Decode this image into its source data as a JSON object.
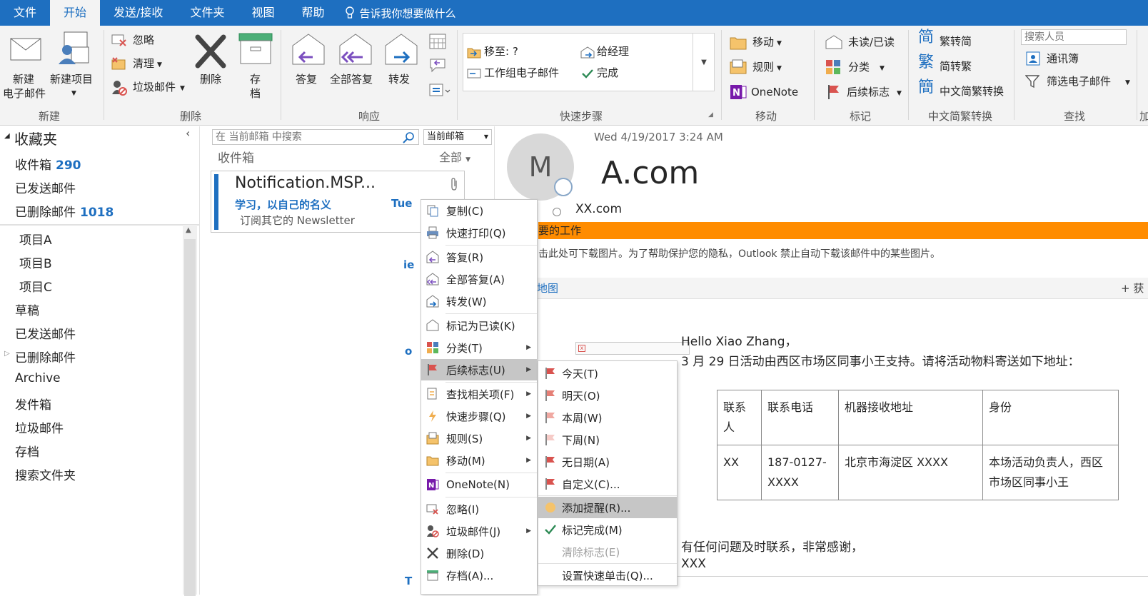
{
  "tabs": [
    "文件",
    "开始",
    "发送/接收",
    "文件夹",
    "视图",
    "帮助"
  ],
  "tell_me": "告诉我你想要做什么",
  "ribbon": {
    "new_email": [
      "新建",
      "电子邮件"
    ],
    "new_items": [
      "新建项目"
    ],
    "ignore": "忽略",
    "cleanup": "清理",
    "junk": "垃圾邮件",
    "delete": "删除",
    "archive": [
      "存",
      "档"
    ],
    "reply": "答复",
    "reply_all": "全部答复",
    "forward": "转发",
    "qs_move_to": "移至: ?",
    "qs_manager": "给经理",
    "qs_team": "工作组电子邮件",
    "qs_done": "完成",
    "move": "移动",
    "rules": "规则",
    "onenote": "OneNote",
    "unread": "未读/已读",
    "categorize": "分类",
    "followup": "后续标志",
    "trad": "繁转简",
    "simp": "简转繁",
    "convert": "中文简繁转换",
    "search_people": "搜索人员",
    "address_book": "通讯簿",
    "filter_email": "筛选电子邮件",
    "groups": {
      "new": "新建",
      "delete": "删除",
      "respond": "响应",
      "quick_steps": "快速步骤",
      "move": "移动",
      "tags": "标记",
      "cn_convert": "中文简繁转换",
      "find": "查找",
      "addin": "加"
    }
  },
  "folders": {
    "favorites": "收藏夹",
    "fav_items": [
      {
        "label": "收件箱",
        "count": "290"
      },
      {
        "label": "已发送邮件",
        "count": ""
      },
      {
        "label": "已删除邮件",
        "count": "1018"
      }
    ],
    "items": [
      "项目A",
      "项目B",
      "项目C",
      "草稿",
      "已发送邮件",
      "已删除邮件",
      "Archive",
      "发件箱",
      "垃圾邮件",
      "存档",
      "搜索文件夹"
    ]
  },
  "list": {
    "search_placeholder": "在 当前邮箱 中搜索",
    "scope": "当前邮箱",
    "folder": "收件箱",
    "filter": "全部",
    "msg_from": "Notification.MSP...",
    "msg_subject": "学习，以自己的名义",
    "msg_date": "Tue",
    "msg_preview": "订阅其它的 Newsletter",
    "frag_1": "ie",
    "frag_2": "o",
    "frag_3": "T"
  },
  "reading": {
    "date": "Wed 4/19/2017 3:24 AM",
    "avatar": "M",
    "sender": "A.com",
    "to": "XX.com",
    "banner": "要的工作",
    "info": "击此处可下载图片。为了帮助保护您的隐私，Outlook 禁止自动下载该邮件中的某些图片。",
    "map": "地图",
    "plus": "+ 获",
    "greeting": "Hello Xiao Zhang，",
    "line1": "3 月 29 日活动由西区市场区同事小王支持。请将活动物料寄送如下地址：",
    "table_head": [
      "联系人",
      "联系电话",
      "机器接收地址",
      "身份"
    ],
    "table_row": [
      "XX",
      "187-0127-XXXX",
      "北京市海淀区 XXXX",
      "本场活动负责人，西区市场区同事小王"
    ],
    "closing": "有任何问题及时联系，非常感谢，",
    "sign": "XXX"
  },
  "menu": [
    {
      "label": "复制(C)",
      "icon": "copy-icon"
    },
    {
      "label": "快速打印(Q)",
      "icon": "print-icon"
    },
    {
      "label": "答复(R)",
      "icon": "reply-icon"
    },
    {
      "label": "全部答复(A)",
      "icon": "reply-all-icon"
    },
    {
      "label": "转发(W)",
      "icon": "forward-icon"
    },
    {
      "label": "标记为已读(K)",
      "icon": "envelope-icon"
    },
    {
      "label": "分类(T)",
      "icon": "categorize-icon"
    },
    {
      "label": "后续标志(U)",
      "icon": "flag-icon"
    },
    {
      "label": "查找相关项(F)",
      "icon": "find-related-icon"
    },
    {
      "label": "快速步骤(Q)",
      "icon": "lightning-icon"
    },
    {
      "label": "规则(S)",
      "icon": "rules-icon"
    },
    {
      "label": "移动(M)",
      "icon": "move-icon"
    },
    {
      "label": "OneNote(N)",
      "icon": "onenote-icon"
    },
    {
      "label": "忽略(I)",
      "icon": "ignore-icon"
    },
    {
      "label": "垃圾邮件(J)",
      "icon": "junk-icon"
    },
    {
      "label": "删除(D)",
      "icon": "delete-icon"
    },
    {
      "label": "存档(A)...",
      "icon": "archive-icon"
    }
  ],
  "submenu": [
    {
      "label": "今天(T)"
    },
    {
      "label": "明天(O)"
    },
    {
      "label": "本周(W)"
    },
    {
      "label": "下周(N)"
    },
    {
      "label": "无日期(A)"
    },
    {
      "label": "自定义(C)..."
    },
    {
      "label": "添加提醒(R)..."
    },
    {
      "label": "标记完成(M)"
    },
    {
      "label": "清除标志(E)"
    },
    {
      "label": "设置快速单击(Q)..."
    }
  ],
  "colors": {
    "accent": "#1e6fc0",
    "banner": "#ff8c00",
    "flag": "#d9534f",
    "highlight": "#c6c6c6"
  }
}
